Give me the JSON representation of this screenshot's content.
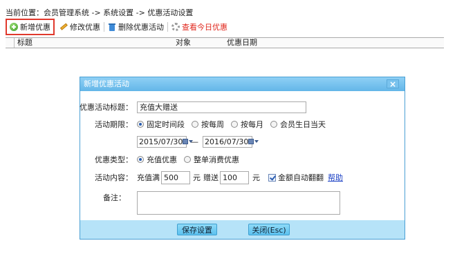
{
  "breadcrumb": "当前位置：会员管理系统 -> 系统设置 -> 优惠活动设置",
  "toolbar": {
    "add_label": "新增优惠",
    "edit_label": "修改优惠",
    "delete_label": "删除优惠活动",
    "today_label": "查看今日优惠"
  },
  "grid": {
    "columns": [
      "标题",
      "对象",
      "优惠日期"
    ]
  },
  "dialog": {
    "title": "新增优惠活动",
    "close_glyph": "×",
    "title_label": "优惠活动标题：",
    "title_value": "充值大赠送",
    "period_label": "活动期限：",
    "period_options": [
      "固定时间段",
      "按每周",
      "按每月",
      "会员生日当天"
    ],
    "period_selected": "固定时间段",
    "start_date": "2015/07/30",
    "end_date": "2016/07/30",
    "date_separator": "—",
    "type_label": "优惠类型：",
    "type_options": [
      "充值优惠",
      "整单消费优惠"
    ],
    "type_selected": "充值优惠",
    "content_label": "活动内容：",
    "recharge_prefix": "充值满",
    "recharge_amount": "500",
    "unit_yuan": "元",
    "gift_prefix": "赠送",
    "gift_amount": "100",
    "unit_yuan2": "元",
    "auto_double_label": "金额自动翻翻",
    "auto_double_checked": true,
    "help_link": "帮助",
    "memo_label": "备注：",
    "memo_value": "",
    "save_button": "保存设置",
    "close_button": "关闭(Esc)"
  }
}
